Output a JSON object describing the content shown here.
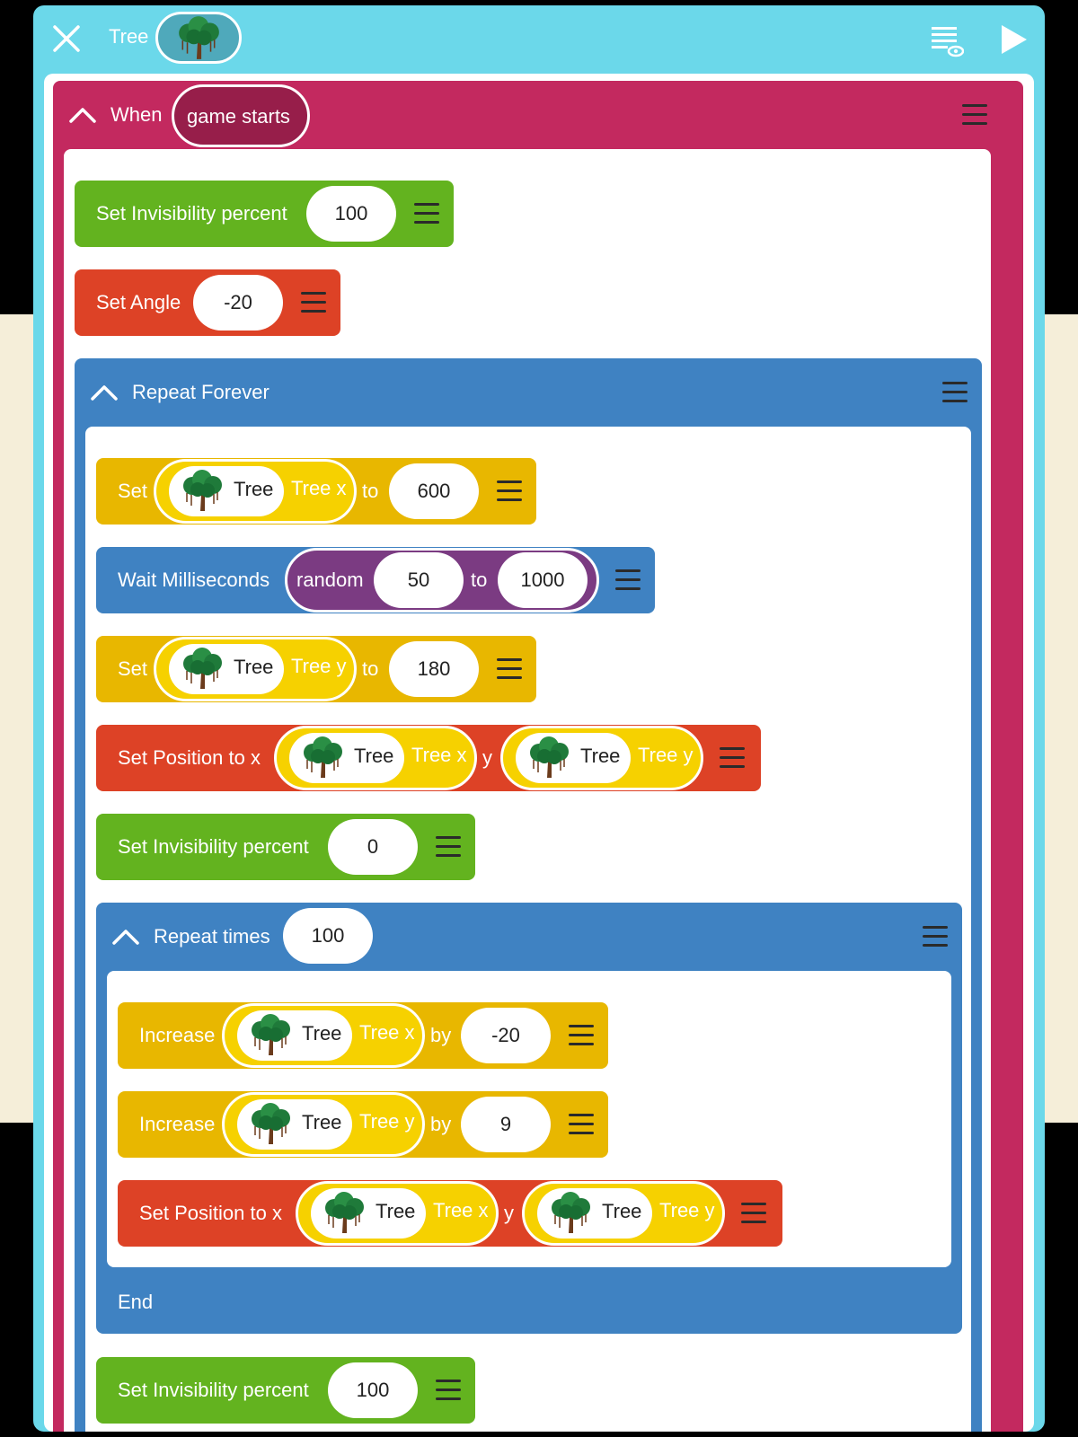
{
  "header": {
    "title": "Tree",
    "close_icon": "close-icon",
    "log_icon": "document-eye-icon",
    "play_icon": "play-icon"
  },
  "event": {
    "when_label": "When",
    "trigger": "game starts"
  },
  "blocks": {
    "set_invis_1": {
      "label": "Set Invisibility percent",
      "value": "100"
    },
    "set_angle": {
      "label": "Set Angle",
      "value": "-20"
    },
    "repeat_forever": {
      "label": "Repeat Forever"
    },
    "set_x": {
      "set": "Set",
      "obj": "Tree",
      "var": "Tree x",
      "to": "to",
      "value": "600"
    },
    "wait": {
      "label": "Wait Milliseconds",
      "random": "random",
      "min": "50",
      "to": "to",
      "max": "1000"
    },
    "set_y": {
      "set": "Set",
      "obj": "Tree",
      "var": "Tree y",
      "to": "to",
      "value": "180"
    },
    "set_pos_1": {
      "label": "Set Position to x",
      "obj_x": "Tree",
      "var_x": "Tree x",
      "y": "y",
      "obj_y": "Tree",
      "var_y": "Tree y"
    },
    "set_invis_2": {
      "label": "Set Invisibility percent",
      "value": "0"
    },
    "repeat_times": {
      "label": "Repeat times",
      "value": "100",
      "end": "End"
    },
    "inc_x": {
      "label": "Increase",
      "obj": "Tree",
      "var": "Tree x",
      "by": "by",
      "value": "-20"
    },
    "inc_y": {
      "label": "Increase",
      "obj": "Tree",
      "var": "Tree y",
      "by": "by",
      "value": "9"
    },
    "set_pos_2": {
      "label": "Set Position to x",
      "obj_x": "Tree",
      "var_x": "Tree x",
      "y": "y",
      "obj_y": "Tree",
      "var_y": "Tree y"
    },
    "set_invis_3": {
      "label": "Set Invisibility percent",
      "value": "100"
    }
  },
  "colors": {
    "panel": "#6bd8ea",
    "event": "#c3295f",
    "green": "#63b31f",
    "red": "#dd4226",
    "yellow": "#e8b700",
    "blue": "#3f82c2",
    "variable": "#f6d100",
    "random": "#7b3b82"
  }
}
